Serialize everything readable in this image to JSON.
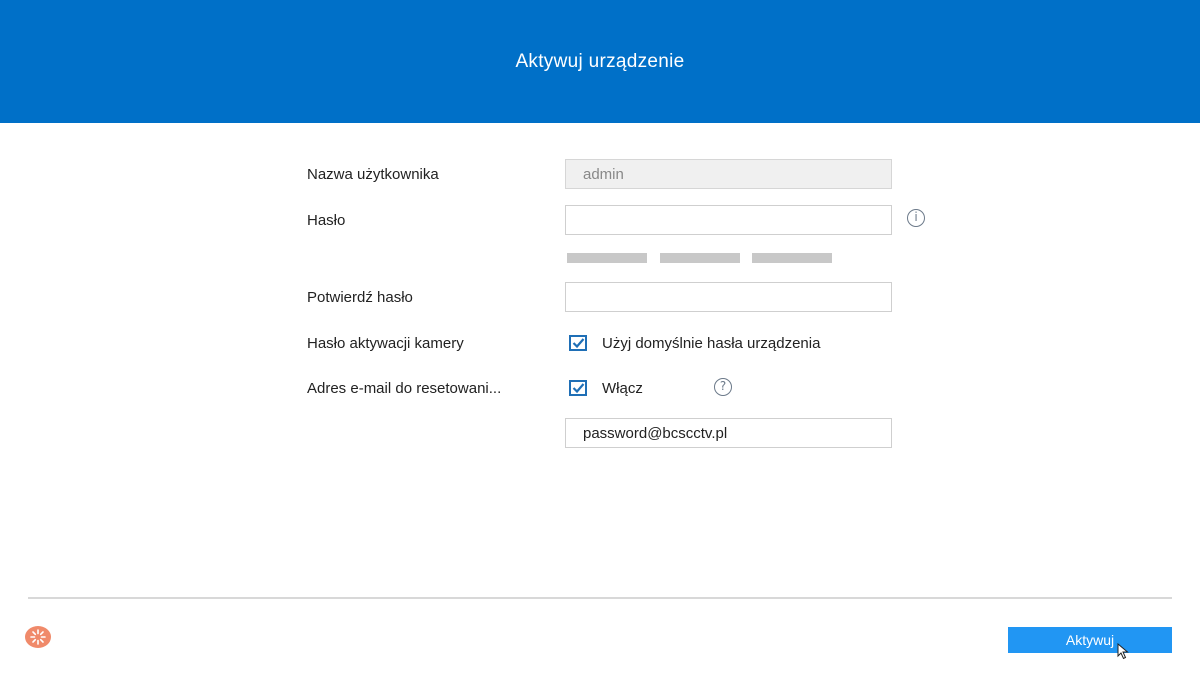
{
  "header": {
    "title": "Aktywuj urządzenie"
  },
  "form": {
    "username": {
      "label": "Nazwa użytkownika",
      "value": "admin"
    },
    "password": {
      "label": "Hasło",
      "value": "",
      "info_icon": "info-icon",
      "strength_bars": 3
    },
    "confirm_password": {
      "label": "Potwierdź hasło",
      "value": ""
    },
    "camera_activation": {
      "label": "Hasło aktywacji kamery",
      "checkbox_label": "Użyj domyślnie hasła urządzenia",
      "checked": true
    },
    "reset_email": {
      "label": "Adres e-mail do resetowani...",
      "checkbox_label": "Włącz",
      "checked": true,
      "help_icon": "help-icon",
      "email": "password@bcscctv.pl"
    }
  },
  "footer": {
    "activate_label": "Aktywuj"
  },
  "colors": {
    "header_bg": "#0070c8",
    "button_bg": "#2196f3",
    "checkbox": "#1f6fb6",
    "logo": "#f08a6a"
  }
}
